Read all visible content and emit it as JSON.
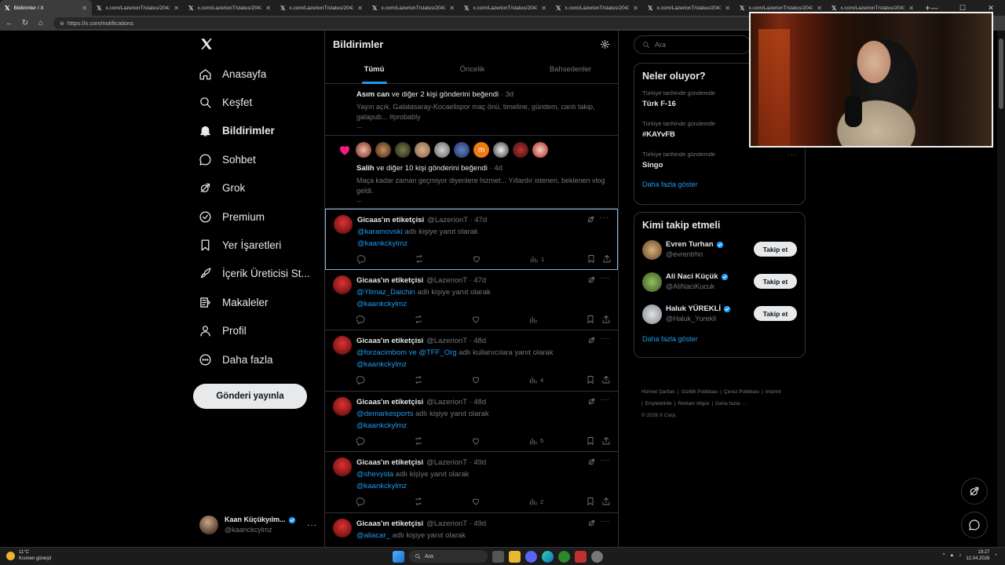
{
  "browser": {
    "tabs": [
      {
        "title": "Bildirimler / X",
        "active": true
      },
      {
        "title": "x.com/LazerionT/status/20435338",
        "active": false
      },
      {
        "title": "x.com/LazerionT/status/20435338",
        "active": false
      },
      {
        "title": "x.com/LazerionT/status/20435338",
        "active": false
      },
      {
        "title": "x.com/LazerionT/status/20435338",
        "active": false
      },
      {
        "title": "x.com/LazerionT/status/20435338",
        "active": false
      },
      {
        "title": "x.com/LazerionT/status/20435338",
        "active": false
      },
      {
        "title": "x.com/LazerionT/status/20435338",
        "active": false
      },
      {
        "title": "x.com/LazerionT/status/20435338",
        "active": false
      },
      {
        "title": "x.com/LazerionT/status/20435338",
        "active": false
      }
    ],
    "url": "https://x.com/notifications"
  },
  "nav": {
    "items": [
      {
        "label": "Anasayfa",
        "icon": "home-icon"
      },
      {
        "label": "Keşfet",
        "icon": "search-icon"
      },
      {
        "label": "Bildirimler",
        "icon": "bell-icon"
      },
      {
        "label": "Sohbet",
        "icon": "chat-icon"
      },
      {
        "label": "Grok",
        "icon": "grok-icon"
      },
      {
        "label": "Premium",
        "icon": "premium-icon"
      },
      {
        "label": "Yer İşaretleri",
        "icon": "bookmark-icon"
      },
      {
        "label": "İçerik Üreticisi St...",
        "icon": "rocket-icon"
      },
      {
        "label": "Makaleler",
        "icon": "article-icon"
      },
      {
        "label": "Profil",
        "icon": "profile-icon"
      },
      {
        "label": "Daha fazla",
        "icon": "more-circle-icon"
      }
    ],
    "post_button": "Gönderi yayınla",
    "account": {
      "name": "Kaan Küçükyılm...",
      "handle": "@kaanckcylmz"
    }
  },
  "timeline": {
    "title": "Bildirimler",
    "tabs": [
      "Tümü",
      "Öncelik",
      "Bahsedenler"
    ],
    "notifications": [
      {
        "actor": "Asım can",
        "action": "ve diğer 2 kişi gönderini beğendi",
        "time": "· 3d",
        "text": "Yayın açık. Galatasaray-Kocaelispor maç önü, timeline, gündem, canlı takip, galapub... #probably",
        "ellipsis": "..."
      },
      {
        "actor": "Salih",
        "action": "ve diğer 10 kişi gönderini beğendi",
        "time": "· 4d",
        "text": "Maça kadar zaman geçmiyor diyenlere hizmet... Yıllardır istenen, beklenen vlog geldi.",
        "ellipsis": "..."
      }
    ],
    "posts": [
      {
        "name": "Gicaas'ın etiketçisi",
        "handle": "@LazerionT · 47d",
        "mention": "@karamovski",
        "mention2": "",
        "reply_text": "adlı kişiye yanıt olarak",
        "tag": "@kaankckylmz",
        "views": "1"
      },
      {
        "name": "Gicaas'ın etiketçisi",
        "handle": "@LazerionT · 47d",
        "mention": "@Yilmaz_Daichin",
        "mention2": "",
        "reply_text": "adlı kişiye yanıt olarak",
        "tag": "@kaankckylmz",
        "views": ""
      },
      {
        "name": "Gicaas'ın etiketçisi",
        "handle": "@LazerionT · 48d",
        "mention": "@forzacimbom ve",
        "mention2": "@TFF_Org",
        "reply_text": "adlı kullanıcılara yanıt olarak",
        "tag": "@kaankckylmz",
        "views": "4"
      },
      {
        "name": "Gicaas'ın etiketçisi",
        "handle": "@LazerionT · 48d",
        "mention": "@demarkesports",
        "mention2": "",
        "reply_text": "adlı kişiye yanıt olarak",
        "tag": "@kaankckylmz",
        "views": "5"
      },
      {
        "name": "Gicaas'ın etiketçisi",
        "handle": "@LazerionT · 49d",
        "mention": "@shevysta",
        "mention2": "",
        "reply_text": "adlı kişiye yanıt olarak",
        "tag": "@kaankckylmz",
        "views": "2"
      },
      {
        "name": "Gicaas'ın etiketçisi",
        "handle": "@LazerionT · 49d",
        "mention": "@aliacar_",
        "mention2": "",
        "reply_text": "adlı kişiye yanıt olarak",
        "tag": "",
        "views": ""
      }
    ]
  },
  "right": {
    "search_placeholder": "Ara",
    "trends_title": "Neler oluyor?",
    "trends": [
      {
        "context": "Türkiye tarihinde gündemde",
        "name": "Türk F-16"
      },
      {
        "context": "Türkiye tarihinde gündemde",
        "name": "#KAYvFB"
      },
      {
        "context": "Türkiye tarihinde gündemde",
        "name": "Singo"
      }
    ],
    "show_more": "Daha fazla göster",
    "who_title": "Kimi takip etmeli",
    "who": [
      {
        "name": "Evren Turhan",
        "handle": "@evrentrhn",
        "button": "Takip et"
      },
      {
        "name": "Ali Naci Küçük",
        "handle": "@AliNaciKucuk",
        "button": "Takip et"
      },
      {
        "name": "Haluk YÜREKLİ",
        "handle": "@Haluk_Yurekli",
        "button": "Takip et"
      }
    ],
    "who_show_more": "Daha fazla göster",
    "footer": [
      "Hizmet Şartları",
      "|",
      "Gizlilik Politikası",
      "|",
      "Çerez Politikası",
      "|",
      "Imprint",
      "|",
      "Erişilebilirlik",
      "|",
      "Reklam bilgisi",
      "|",
      "Daha fazla ···",
      "© 2026 X Corp."
    ]
  },
  "taskbar": {
    "weather_temp": "11°C",
    "weather_desc": "Kısmen güneşli",
    "search": "Ara",
    "time": "19:27",
    "date": "12.04.2026"
  },
  "colors": {
    "accent": "#1d9bf0",
    "like": "#f91880",
    "border": "#2f3336",
    "muted": "#71767b"
  }
}
